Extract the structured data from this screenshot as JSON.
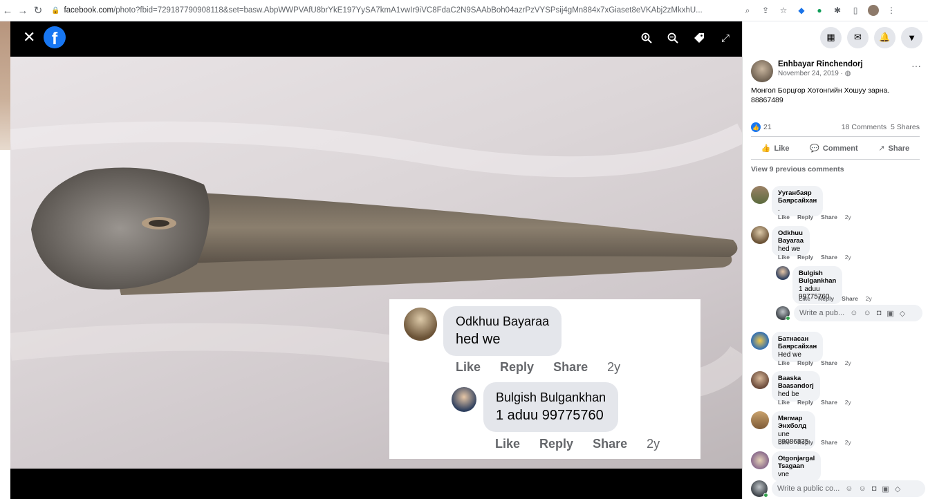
{
  "browser": {
    "url_domain": "facebook.com",
    "url_rest": "/photo?fbid=729187790908118&set=basw.AbpWWPVAfU8brYkE197YySA7kmA1vwIr9iVC8FdaC2N9SAAbBoh04azrPzVYSPsij4gMn884x7xGiaset8eVKAbj2zMkxhU...",
    "nav_icons": [
      "back-arrow-icon",
      "forward-arrow-icon",
      "reload-icon"
    ]
  },
  "viewer": {
    "logo_letter": "f",
    "tools": [
      "zoom-in-icon",
      "zoom-out-icon",
      "tag-icon",
      "fullscreen-icon"
    ]
  },
  "overlay": {
    "comment1": {
      "name": "Odkhuu Bayaraa",
      "text": "hed we",
      "like": "Like",
      "reply": "Reply",
      "share": "Share",
      "age": "2y"
    },
    "comment2": {
      "name": "Bulgish Bulgankhan",
      "text": "1 aduu 99775760",
      "like": "Like",
      "reply": "Reply",
      "share": "Share",
      "age": "2y"
    }
  },
  "post": {
    "author": "Enhbayar Rinchendorj",
    "date": "November 24, 2019 · ",
    "more": "···",
    "text_line1": "Монгол Борцгор Хотонгийн Хошуу зарна.",
    "text_line2": "88867489",
    "reaction_count": "21",
    "comments_count": "18 Comments",
    "shares_count": "5 Shares",
    "like_label": "Like",
    "comment_label": "Comment",
    "share_label": "Share",
    "view_previous": "View 9 previous comments"
  },
  "comments": [
    {
      "name": "Ууганбаяр Баярсайхан",
      "text": ".",
      "age": "2y"
    },
    {
      "name": "Odkhuu Bayaraa",
      "text": "hed we",
      "age": "2y"
    },
    {
      "name": "Bulgish Bulgankhan",
      "text": "1 aduu 99775760",
      "age": "2y"
    },
    {
      "name": "Батнасан Баярсайхан",
      "text": "Hed we",
      "age": "2y"
    },
    {
      "name": "Baaska Baasandorj",
      "text": "hed be",
      "age": "2y"
    },
    {
      "name": "Мягмар Энхболд",
      "text": "une 89086335",
      "age": "2y"
    },
    {
      "name": "Otgonjargal Tsagaan",
      "text": "vne",
      "age": ""
    }
  ],
  "actions": {
    "like": "Like",
    "reply": "Reply",
    "share": "Share"
  },
  "write_reply_placeholder": "Write a pub...",
  "write_comment_placeholder": "Write a public co...",
  "colors": {
    "facebook_blue": "#1877f2",
    "bubble_gray": "#f0f2f5",
    "secondary_text": "#65676b"
  }
}
